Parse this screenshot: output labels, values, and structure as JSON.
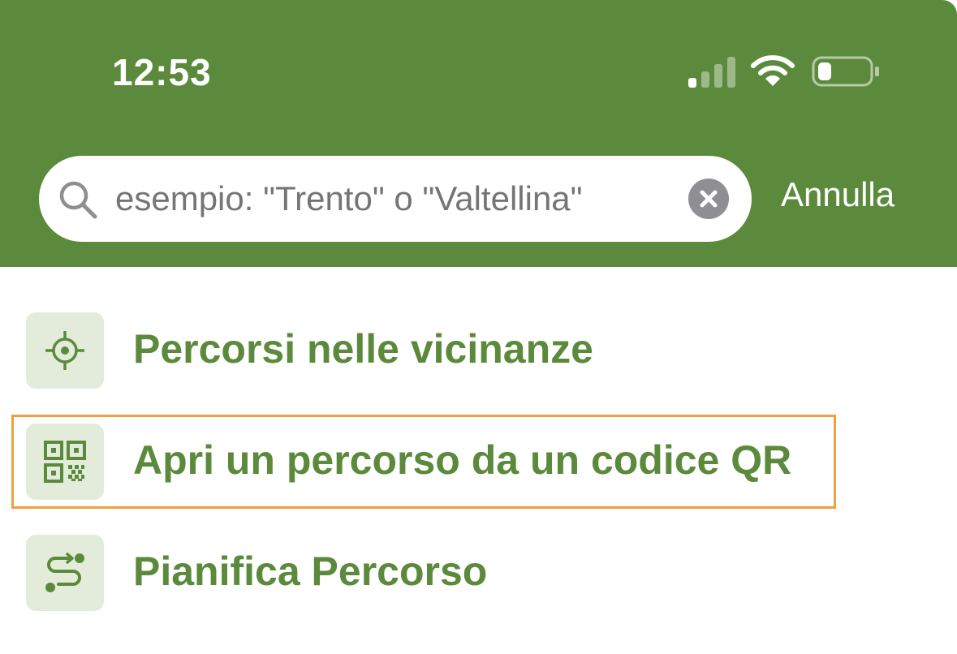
{
  "status_bar": {
    "time": "12:53"
  },
  "search": {
    "placeholder": "esempio: \"Trento\" o \"Valtellina\"",
    "cancel_label": "Annulla"
  },
  "menu": {
    "items": [
      {
        "label": "Percorsi nelle vicinanze",
        "icon": "location-target-icon"
      },
      {
        "label": "Apri un percorso da un codice QR",
        "icon": "qr-code-icon",
        "highlighted": true
      },
      {
        "label": "Pianifica Percorso",
        "icon": "route-plan-icon"
      }
    ]
  },
  "colors": {
    "header": "#5c8a3c",
    "accent_text": "#5c8a3c",
    "icon_tile": "#e3ecdb",
    "highlight_border": "#f0a040"
  }
}
